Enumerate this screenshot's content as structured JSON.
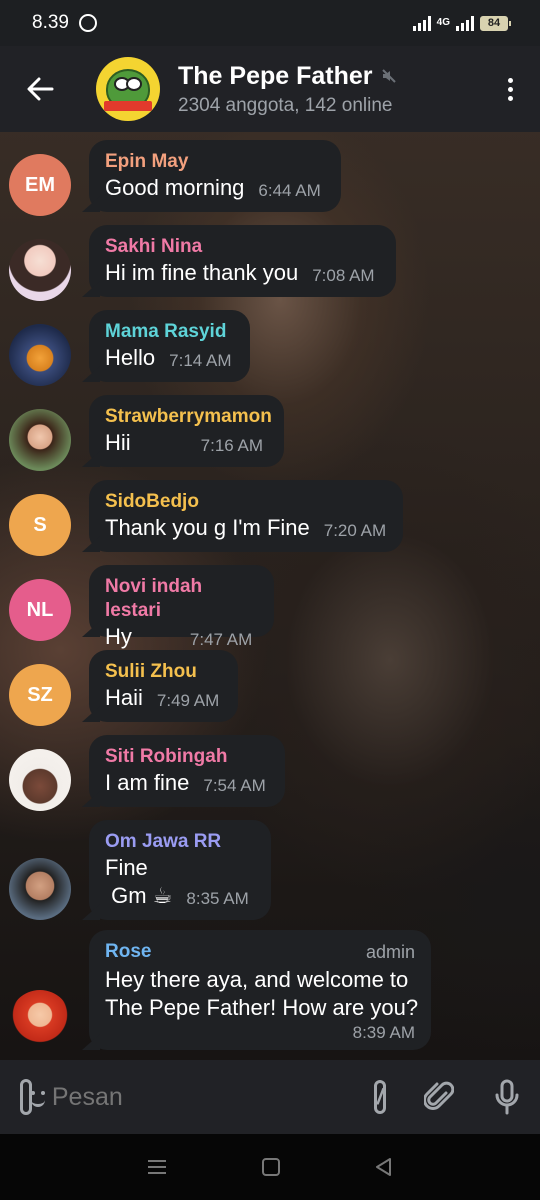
{
  "status_bar": {
    "time": "8.39",
    "network": "4G",
    "battery": "84"
  },
  "header": {
    "title": "The Pepe Father",
    "subtitle": "2304 anggota, 142 online",
    "icons": [
      "back-arrow-icon",
      "muted-icon",
      "more-vert-icon"
    ]
  },
  "messages": [
    {
      "sender": "Epin May",
      "initials": "EM",
      "avatar_color": "#e07a5f",
      "name_color": "#f2a07e",
      "text": "Good morning",
      "time": "6:44 AM"
    },
    {
      "sender": "Sakhi Nina",
      "initials": "",
      "avatar_color": "#f3dde2",
      "name_color": "#f07aa6",
      "text": "Hi im fine thank you",
      "time": "7:08 AM"
    },
    {
      "sender": "Mama Rasyid",
      "initials": "",
      "avatar_color": "#3a4b7a",
      "name_color": "#5ed3d8",
      "text": "Hello",
      "time": "7:14 AM"
    },
    {
      "sender": "Strawberrymamon",
      "initials": "",
      "avatar_color": "#6c8a5a",
      "name_color": "#f4c04e",
      "text": "Hii",
      "time": "7:16 AM"
    },
    {
      "sender": "SidoBedjo",
      "initials": "S",
      "avatar_color": "#eea64e",
      "name_color": "#f4c04e",
      "text": "Thank you g I'm Fine",
      "time": "7:20 AM"
    },
    {
      "sender": "Novi indah lestari",
      "initials": "NL",
      "avatar_color": "#e55d8c",
      "name_color": "#f07aa6",
      "text": "Hy",
      "time": "7:47 AM"
    },
    {
      "sender": "Sulii Zhou",
      "initials": "SZ",
      "avatar_color": "#eea64e",
      "name_color": "#f4c04e",
      "text": "Haii",
      "time": "7:49 AM"
    },
    {
      "sender": "Siti Robingah",
      "initials": "",
      "avatar_color": "#f2eeea",
      "name_color": "#f07aa6",
      "text": "I am fine",
      "time": "7:54 AM"
    },
    {
      "sender": "Om Jawa RR",
      "initials": "",
      "avatar_color": "#5a6c80",
      "name_color": "#9a9cf2",
      "text": "Fine\n Gm ☕",
      "time": "8:35 AM"
    },
    {
      "sender": "Rose",
      "initials": "",
      "avatar_color": "#c22a18",
      "name_color": "#6fb5f1",
      "badge": "admin",
      "text": "Hey there aya, and welcome to\nThe Pepe Father! How are you?",
      "time": "8:39 AM"
    }
  ],
  "input": {
    "placeholder": "Pesan",
    "command_label": "/"
  }
}
